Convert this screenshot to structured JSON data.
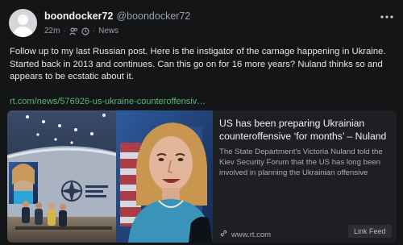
{
  "author": {
    "display_name": "boondocker72",
    "handle": "@boondocker72"
  },
  "meta": {
    "time": "22m",
    "separator": "·",
    "source": "News"
  },
  "post": {
    "text": "Follow up to my last Russian post. Here is the instigator of the carnage happening in Ukraine. Started back in 2013 and continues. Can this go on for 16 more years? Nuland thinks so and appears to be ecstatic about it.",
    "link": "rt.com/news/576926-us-ukraine-counteroffensiv…"
  },
  "card": {
    "title": "US has been preparing Ukrainian counteroffensive ‘for months’ – Nuland",
    "description": "The State Department's Victoria Nuland told the Kiev Security Forum that the US has long been involved in planning the Ukrainian offensive",
    "domain": "www.rt.com",
    "badge": "Link Feed"
  },
  "icons": {
    "more": "more-horizontal-icon",
    "visibility": "people-icon",
    "clock": "clock-icon",
    "link": "link-icon",
    "avatar": "default-avatar-icon"
  },
  "colors": {
    "background": "#141517",
    "link": "#55b874",
    "card": "#1e1f22"
  }
}
